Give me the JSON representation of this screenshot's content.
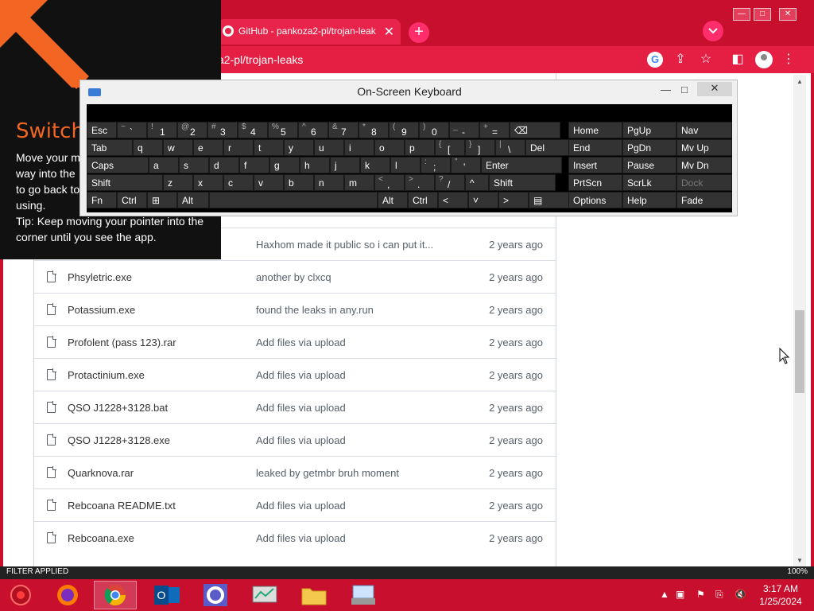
{
  "browser": {
    "tab_title": "GitHub - pankoza2-pl/trojan-leak",
    "tab_close": "✕",
    "new_tab": "+",
    "url": "a2-pl/trojan-leaks",
    "window_minimize": "—",
    "window_maximize": "□",
    "window_close": "✕"
  },
  "switch_panel": {
    "title": "Switch",
    "line1": "Move your m",
    "line2": "way into the",
    "line3": "to go back to",
    "line4": "using.",
    "tip": "Tip: Keep moving your pointer into the corner until you see the app."
  },
  "files": [
    {
      "name": "",
      "message": "Haxhom made it public so i can put it...",
      "age": "2 years ago"
    },
    {
      "name": "Phsyletric.exe",
      "message": "another by clxcq",
      "age": "2 years ago"
    },
    {
      "name": "Potassium.exe",
      "message": "found the leaks in any.run",
      "age": "2 years ago"
    },
    {
      "name": "Profolent (pass 123).rar",
      "message": "Add files via upload",
      "age": "2 years ago"
    },
    {
      "name": "Protactinium.exe",
      "message": "Add files via upload",
      "age": "2 years ago"
    },
    {
      "name": "QSO J1228+3128.bat",
      "message": "Add files via upload",
      "age": "2 years ago"
    },
    {
      "name": "QSO J1228+3128.exe",
      "message": "Add files via upload",
      "age": "2 years ago"
    },
    {
      "name": "Quarknova.rar",
      "message": "leaked by getmbr bruh moment",
      "age": "2 years ago"
    },
    {
      "name": "Rebcoana README.txt",
      "message": "Add files via upload",
      "age": "2 years ago"
    },
    {
      "name": "Rebcoana.exe",
      "message": "Add files via upload",
      "age": "2 years ago"
    }
  ],
  "keyboard": {
    "title": "On-Screen Keyboard",
    "minimize": "—",
    "maximize": "□",
    "close": "✕",
    "row1": {
      "esc": "Esc",
      "keys": [
        {
          "shift": "~",
          "main": "`"
        },
        {
          "shift": "!",
          "main": "1"
        },
        {
          "shift": "@",
          "main": "2"
        },
        {
          "shift": "#",
          "main": "3"
        },
        {
          "shift": "$",
          "main": "4"
        },
        {
          "shift": "%",
          "main": "5"
        },
        {
          "shift": "^",
          "main": "6"
        },
        {
          "shift": "&",
          "main": "7"
        },
        {
          "shift": "*",
          "main": "8"
        },
        {
          "shift": "(",
          "main": "9"
        },
        {
          "shift": ")",
          "main": "0"
        },
        {
          "shift": "_",
          "main": "-"
        },
        {
          "shift": "+",
          "main": "="
        }
      ],
      "backspace": "⌫"
    },
    "row2": [
      "Tab",
      "q",
      "w",
      "e",
      "r",
      "t",
      "y",
      "u",
      "i",
      "o",
      "p",
      "[",
      "]",
      "\\",
      "Del"
    ],
    "row2_shift": [
      "",
      "",
      "",
      "",
      "",
      "",
      "",
      "",
      "",
      "",
      "",
      "{",
      "}",
      "|",
      ""
    ],
    "row3": [
      "Caps",
      "a",
      "s",
      "d",
      "f",
      "g",
      "h",
      "j",
      "k",
      "l",
      ";",
      "'",
      "Enter"
    ],
    "row3_shift": [
      "",
      "",
      "",
      "",
      "",
      "",
      "",
      "",
      "",
      "",
      ":",
      "\"",
      ""
    ],
    "row4": [
      "Shift",
      "z",
      "x",
      "c",
      "v",
      "b",
      "n",
      "m",
      ",",
      ".",
      "/",
      "^",
      "Shift"
    ],
    "row4_shift": [
      "",
      "",
      "",
      "",
      "",
      "",
      "",
      "",
      "<",
      ">",
      "?",
      "",
      ""
    ],
    "row5": [
      "Fn",
      "Ctrl",
      "⊞",
      "Alt",
      "",
      "Alt",
      "Ctrl",
      "<",
      "˅",
      ">",
      "▤"
    ],
    "nav": [
      [
        "Home",
        "PgUp",
        "Nav"
      ],
      [
        "End",
        "PgDn",
        "Mv Up"
      ],
      [
        "Insert",
        "Pause",
        "Mv Dn"
      ],
      [
        "PrtScn",
        "ScrLk",
        "Dock"
      ],
      [
        "Options",
        "Help",
        "Fade"
      ]
    ]
  },
  "status_strip": {
    "left": "FILTER APPLIED",
    "right": "100%"
  },
  "taskbar": {
    "time": "3:17 AM",
    "date": "1/25/2024",
    "tray_arrow": "▲"
  },
  "colors": {
    "accent": "#c8102e",
    "switch_title": "#f26522",
    "osk_key": "#333333"
  }
}
